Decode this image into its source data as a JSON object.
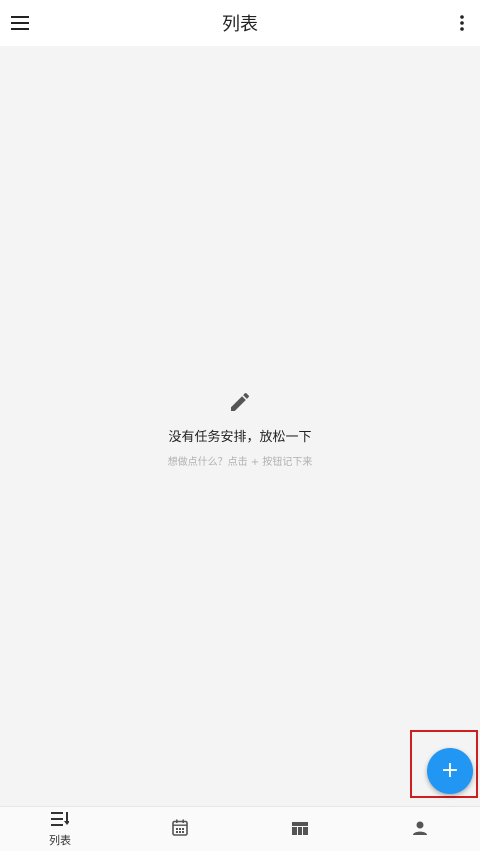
{
  "topbar": {
    "title": "列表",
    "menu_icon": "menu-icon",
    "more_icon": "more-vert-icon"
  },
  "empty_state": {
    "icon": "pencil-icon",
    "message": "没有任务安排，放松一下",
    "hint": "想做点什么？点击 + 按钮记下来"
  },
  "fab": {
    "label": "+",
    "icon": "add-icon",
    "color": "#2196f3"
  },
  "bottom_nav": {
    "items": [
      {
        "icon": "list-icon",
        "label": "列表"
      },
      {
        "icon": "calendar-icon",
        "label": ""
      },
      {
        "icon": "board-icon",
        "label": ""
      },
      {
        "icon": "person-icon",
        "label": ""
      }
    ]
  }
}
